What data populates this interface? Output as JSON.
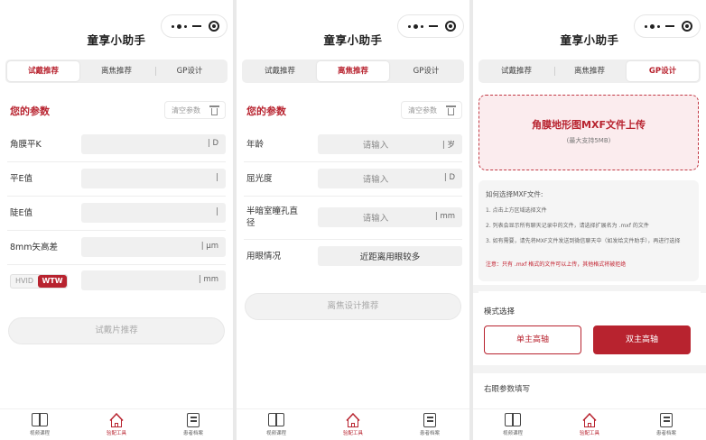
{
  "app_title": "童享小助手",
  "tabs": [
    "试戴推荐",
    "离焦推荐",
    "GP设计"
  ],
  "nav": [
    "视频课程",
    "验配工具",
    "患者档案"
  ],
  "colors": {
    "accent": "#b8232f",
    "field_bg": "#f0f0f0"
  },
  "panel1": {
    "section_title": "您的参数",
    "clear_label": "清空参数",
    "rows": [
      {
        "label": "角膜平K",
        "unit": "D"
      },
      {
        "label": "平E值",
        "unit": ""
      },
      {
        "label": "陡E值",
        "unit": ""
      },
      {
        "label": "8mm矢高差",
        "unit": "μm"
      }
    ],
    "toggle": {
      "opt1": "HVID",
      "opt2": "WTW",
      "unit": "mm"
    },
    "submit_label": "试戴片推荐"
  },
  "panel2": {
    "section_title": "您的参数",
    "clear_label": "清空参数",
    "rows": [
      {
        "label": "年龄",
        "placeholder": "请输入",
        "unit": "岁"
      },
      {
        "label": "屈光度",
        "placeholder": "请输入",
        "unit": "D"
      },
      {
        "label": "半暗室瞳孔直径",
        "placeholder": "请输入",
        "unit": "mm"
      }
    ],
    "eye_use": {
      "label": "用眼情况",
      "value": "近距离用眼较多"
    },
    "submit_label": "离焦设计推荐"
  },
  "panel3": {
    "upload_title": "角膜地形图MXF文件上传",
    "upload_sub": "(最大支持5MB)",
    "howto_title": "如何选择MXF文件:",
    "steps": [
      "1. 点击上方区域选择文件",
      "2. 列表会显示所有聊天记录中的文件，请选择扩展名为 .mxf 的文件",
      "3. 如有需要，请先将MXF文件发送到微信聊天中（如发给文件助手），再进行选择"
    ],
    "warning": "注意：只有 .mxf 格式的文件可以上传，其他格式将被拒绝",
    "mode_title": "模式选择",
    "mode_options": [
      "单主高轴",
      "双主高轴"
    ],
    "right_eye_title": "右眼参数填写"
  }
}
